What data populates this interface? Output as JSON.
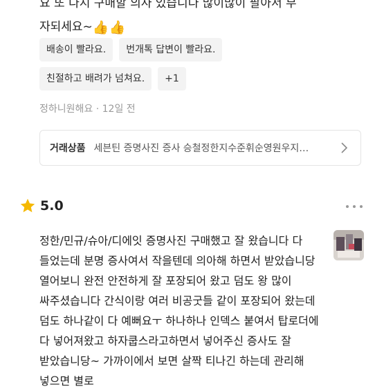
{
  "prev_review": {
    "text_line1": "요 또 다시 구매할 의사 있습니다 많이많이 팔아서 부",
    "text_line2": "자되세요~",
    "emoji": "👍👍",
    "tags": [
      "배송이 빨라요.",
      "번개톡 답변이 빨라요.",
      "친절하고 배려가 넘쳐요.",
      "+1"
    ],
    "author": "정하니원해요",
    "separator": "·",
    "time": "12일 전"
  },
  "product_card": {
    "label": "거래상품",
    "name": "세븐틴 증명사진 증사 승철정한지수준휘순영원우지…"
  },
  "review": {
    "score": "5.0",
    "body": "정한/민규/슈아/디에잇 증명사진 구매했고 잘 왔습니다 다 들었는데 분명 증사여서 작을텐데 의아해 하면서 받았습니당 열어보니 완전 안전하게 잘 포장되어 왔고 덤도 왕 많이 싸주셨습니다 간식이랑 여러 비공굿들 같이 포장되어 왔는데 덤도 하나같이 다 예뻐요ㅜ 하나하나 인덱스 붙여서 탑로더에 다 넣어져왔고 하자쿱스라고하면서 넣어주신 증사도 잘 받았습니당~ 가까이에서 보면 살짝 티나긴 하는데 관리해 넣으면 별로"
  },
  "colors": {
    "star": "#f5b800",
    "chip_bg": "#f3f3f3",
    "meta": "#9a9a9a"
  }
}
